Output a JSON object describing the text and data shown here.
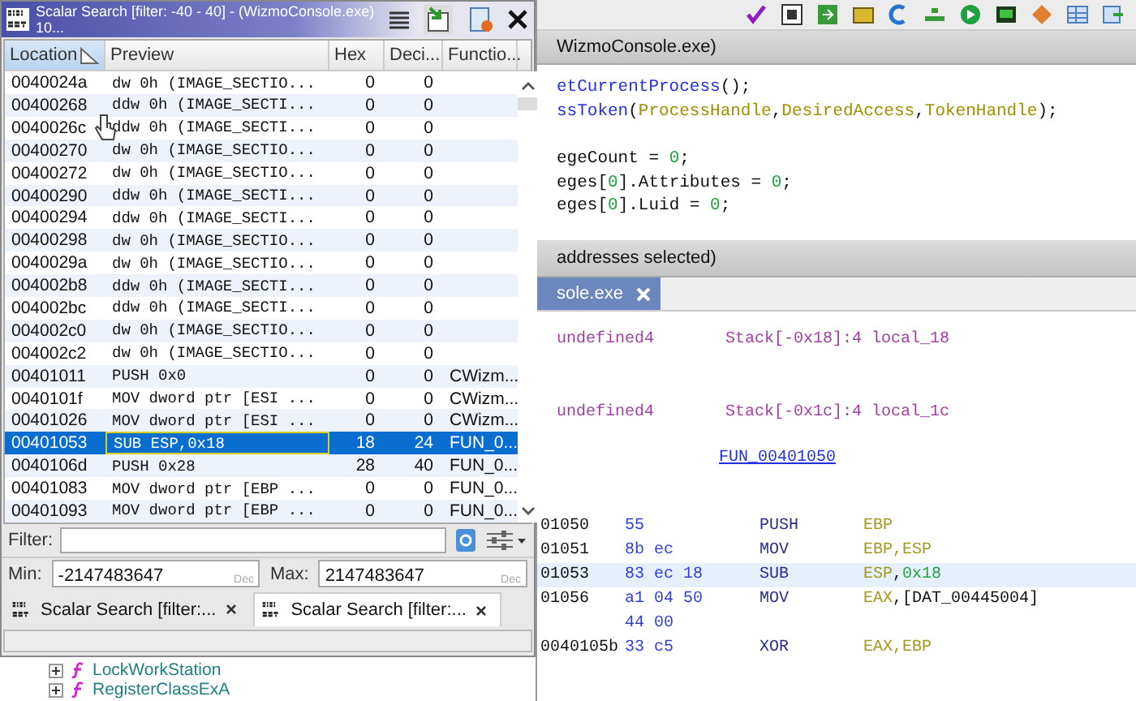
{
  "decompiler": {
    "header": "WizmoConsole.exe)",
    "lines": [
      [
        {
          "text": "etCurrentProcess",
          "kind": "function"
        },
        {
          "text": "();",
          "kind": "plain"
        }
      ],
      [
        {
          "text": "ssToken",
          "kind": "function"
        },
        {
          "text": "(",
          "kind": "plain"
        },
        {
          "text": "ProcessHandle",
          "kind": "param"
        },
        {
          "text": ",",
          "kind": "plain"
        },
        {
          "text": "DesiredAccess",
          "kind": "param"
        },
        {
          "text": ",",
          "kind": "plain"
        },
        {
          "text": "TokenHandle",
          "kind": "param"
        },
        {
          "text": ");",
          "kind": "plain"
        }
      ],
      [
        {
          "text": "egeCount = ",
          "kind": "plain"
        },
        {
          "text": "0",
          "kind": "number"
        },
        {
          "text": ";",
          "kind": "plain"
        }
      ],
      [
        {
          "text": "eges[",
          "kind": "plain"
        },
        {
          "text": "0",
          "kind": "number"
        },
        {
          "text": "].Attributes = ",
          "kind": "plain"
        },
        {
          "text": "0",
          "kind": "number"
        },
        {
          "text": ";",
          "kind": "plain"
        }
      ],
      [
        {
          "text": "eges[",
          "kind": "plain"
        },
        {
          "text": "0",
          "kind": "number"
        },
        {
          "text": "].Luid = ",
          "kind": "plain"
        },
        {
          "text": "0",
          "kind": "number"
        },
        {
          "text": ";",
          "kind": "plain"
        }
      ]
    ]
  },
  "listing": {
    "header": "addresses selected)",
    "tab": "sole.exe",
    "locals": [
      {
        "type": "undefined4",
        "storage": "Stack[-0x18]:4 local_18"
      },
      {
        "type": "undefined4",
        "storage": "Stack[-0x1c]:4 local_1c"
      }
    ],
    "label": "FUN_00401050",
    "rows": [
      {
        "address": "01050",
        "bytes": "55",
        "mnemonic": "PUSH",
        "operands": [
          {
            "text": "EBP",
            "kind": "register"
          }
        ],
        "selected": false
      },
      {
        "address": "01051",
        "bytes": "8b ec",
        "mnemonic": "MOV",
        "operands": [
          {
            "text": "EBP,ESP",
            "kind": "register"
          }
        ],
        "selected": false
      },
      {
        "address": "01053",
        "bytes": "83 ec 18",
        "mnemonic": "SUB",
        "operands": [
          {
            "text": "ESP",
            "kind": "register"
          },
          {
            "text": ",",
            "kind": "plain"
          },
          {
            "text": "0x18",
            "kind": "number"
          }
        ],
        "selected": true
      },
      {
        "address": "01056",
        "bytes": "a1 04 50",
        "mnemonic": "MOV",
        "operands": [
          {
            "text": "EAX",
            "kind": "register"
          },
          {
            "text": ",[DAT_00445004]",
            "kind": "plain"
          }
        ],
        "selected": false
      },
      {
        "address": "",
        "bytes": "44 00",
        "mnemonic": "",
        "operands": [],
        "selected": false
      },
      {
        "address": "0040105b",
        "bytes": "33 c5",
        "mnemonic": "XOR",
        "operands": [
          {
            "text": "EAX,EBP",
            "kind": "register"
          }
        ],
        "selected": false
      }
    ]
  },
  "tree": [
    {
      "label": "LockWorkStation"
    },
    {
      "label": "RegisterClassExA"
    }
  ],
  "scalar_search": {
    "title": "Scalar Search [filter: -40 - 40] - (WizmoConsole.exe) 10...",
    "columns": [
      {
        "label": "Location",
        "sorted": true
      },
      {
        "label": "Preview",
        "sorted": false
      },
      {
        "label": "Hex",
        "sorted": false
      },
      {
        "label": "Deci...",
        "sorted": false
      },
      {
        "label": "Functio...",
        "sorted": false
      }
    ],
    "rows": [
      {
        "location": "0040024a",
        "preview": "dw 0h (IMAGE_SECTIO...",
        "hex": "0",
        "decimal": "0",
        "function": "",
        "selected": false
      },
      {
        "location": "00400268",
        "preview": "ddw 0h (IMAGE_SECTI...",
        "hex": "0",
        "decimal": "0",
        "function": "",
        "selected": false
      },
      {
        "location": "0040026c",
        "preview": "ddw 0h (IMAGE_SECTI...",
        "hex": "0",
        "decimal": "0",
        "function": "",
        "selected": false
      },
      {
        "location": "00400270",
        "preview": "dw 0h (IMAGE_SECTIO...",
        "hex": "0",
        "decimal": "0",
        "function": "",
        "selected": false
      },
      {
        "location": "00400272",
        "preview": "dw 0h (IMAGE_SECTIO...",
        "hex": "0",
        "decimal": "0",
        "function": "",
        "selected": false
      },
      {
        "location": "00400290",
        "preview": "ddw 0h (IMAGE_SECTI...",
        "hex": "0",
        "decimal": "0",
        "function": "",
        "selected": false
      },
      {
        "location": "00400294",
        "preview": "ddw 0h (IMAGE_SECTI...",
        "hex": "0",
        "decimal": "0",
        "function": "",
        "selected": false
      },
      {
        "location": "00400298",
        "preview": "dw 0h (IMAGE_SECTIO...",
        "hex": "0",
        "decimal": "0",
        "function": "",
        "selected": false
      },
      {
        "location": "0040029a",
        "preview": "dw 0h (IMAGE_SECTIO...",
        "hex": "0",
        "decimal": "0",
        "function": "",
        "selected": false
      },
      {
        "location": "004002b8",
        "preview": "ddw 0h (IMAGE_SECTI...",
        "hex": "0",
        "decimal": "0",
        "function": "",
        "selected": false
      },
      {
        "location": "004002bc",
        "preview": "ddw 0h (IMAGE_SECTI...",
        "hex": "0",
        "decimal": "0",
        "function": "",
        "selected": false
      },
      {
        "location": "004002c0",
        "preview": "dw 0h (IMAGE_SECTIO...",
        "hex": "0",
        "decimal": "0",
        "function": "",
        "selected": false
      },
      {
        "location": "004002c2",
        "preview": "dw 0h (IMAGE_SECTIO...",
        "hex": "0",
        "decimal": "0",
        "function": "",
        "selected": false
      },
      {
        "location": "00401011",
        "preview": "PUSH 0x0",
        "hex": "0",
        "decimal": "0",
        "function": "CWizm...",
        "selected": false
      },
      {
        "location": "0040101f",
        "preview": "MOV dword ptr [ESI ...",
        "hex": "0",
        "decimal": "0",
        "function": "CWizm...",
        "selected": false
      },
      {
        "location": "00401026",
        "preview": "MOV dword ptr [ESI ...",
        "hex": "0",
        "decimal": "0",
        "function": "CWizm...",
        "selected": false
      },
      {
        "location": "00401053",
        "preview": "SUB ESP,0x18",
        "hex": "18",
        "decimal": "24",
        "function": "FUN_0...",
        "selected": true
      },
      {
        "location": "0040106d",
        "preview": "PUSH 0x28",
        "hex": "28",
        "decimal": "40",
        "function": "FUN_0...",
        "selected": false
      },
      {
        "location": "00401083",
        "preview": "MOV dword ptr [EBP ...",
        "hex": "0",
        "decimal": "0",
        "function": "FUN_0...",
        "selected": false
      },
      {
        "location": "00401093",
        "preview": "MOV dword ptr [EBP ...",
        "hex": "0",
        "decimal": "0",
        "function": "FUN_0...",
        "selected": false
      }
    ],
    "filter": {
      "label": "Filter:"
    },
    "min": {
      "label": "Min:",
      "value": "-2147483647",
      "hint": "Dec"
    },
    "max": {
      "label": "Max:",
      "value": "2147483647",
      "hint": "Dec"
    },
    "tabs": [
      {
        "label": "Scalar Search [filter:...",
        "selected": false
      },
      {
        "label": "Scalar Search [filter:...",
        "selected": true
      }
    ]
  }
}
